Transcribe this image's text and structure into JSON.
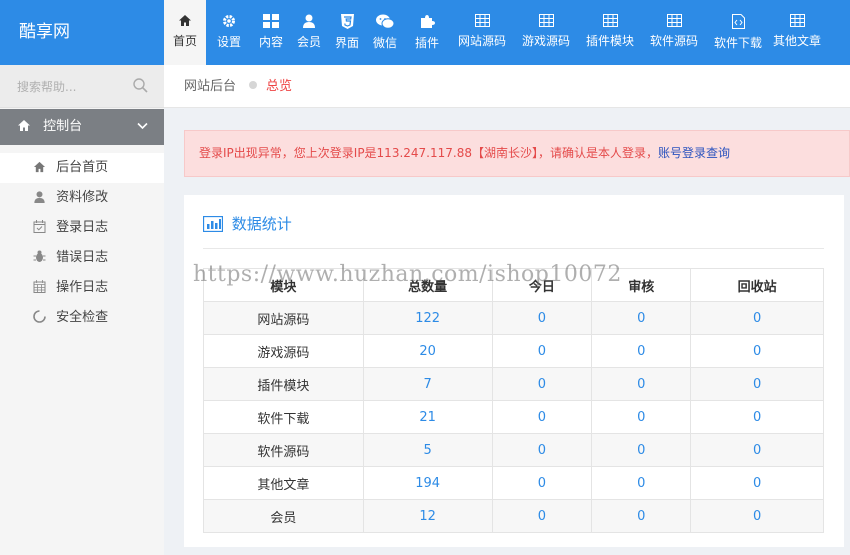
{
  "brand": "酷享网",
  "nav": [
    {
      "label": "首页",
      "icon": "home-icon",
      "active": true
    },
    {
      "label": "设置",
      "icon": "gear-icon"
    },
    {
      "label": "内容",
      "icon": "grid-icon"
    },
    {
      "label": "会员",
      "icon": "user-icon"
    },
    {
      "label": "界面",
      "icon": "html5-icon"
    },
    {
      "label": "微信",
      "icon": "wechat-icon"
    },
    {
      "label": "插件",
      "icon": "puzzle-icon"
    },
    {
      "label": "网站源码",
      "icon": "table-icon"
    },
    {
      "label": "游戏源码",
      "icon": "table-icon"
    },
    {
      "label": "插件模块",
      "icon": "table-icon"
    },
    {
      "label": "软件源码",
      "icon": "table-icon"
    },
    {
      "label": "软件下载",
      "icon": "file-code-icon"
    },
    {
      "label": "其他文章",
      "icon": "table-icon"
    }
  ],
  "sidebar": {
    "search_placeholder": "搜索帮助...",
    "section_title": "控制台",
    "items": [
      {
        "label": "后台首页",
        "icon": "home-icon"
      },
      {
        "label": "资料修改",
        "icon": "user-icon"
      },
      {
        "label": "登录日志",
        "icon": "calendar-check-icon"
      },
      {
        "label": "错误日志",
        "icon": "bug-icon"
      },
      {
        "label": "操作日志",
        "icon": "calendar-icon"
      },
      {
        "label": "安全检查",
        "icon": "spinner-icon"
      }
    ]
  },
  "breadcrumb": {
    "root": "网站后台",
    "current": "总览"
  },
  "alert": {
    "text": "登录IP出现异常，您上次登录IP是113.247.117.88【湖南长沙】，请确认是本人登录，",
    "link": "账号登录查询"
  },
  "stats": {
    "title": "数据统计",
    "columns": [
      "模块",
      "总数量",
      "今日",
      "审核",
      "回收站"
    ],
    "rows": [
      [
        "网站源码",
        "122",
        "0",
        "0",
        "0"
      ],
      [
        "游戏源码",
        "20",
        "0",
        "0",
        "0"
      ],
      [
        "插件模块",
        "7",
        "0",
        "0",
        "0"
      ],
      [
        "软件下载",
        "21",
        "0",
        "0",
        "0"
      ],
      [
        "软件源码",
        "5",
        "0",
        "0",
        "0"
      ],
      [
        "其他文章",
        "194",
        "0",
        "0",
        "0"
      ],
      [
        "会员",
        "12",
        "0",
        "0",
        "0"
      ]
    ]
  },
  "watermark": "https://www.huzhan.com/ishop10072",
  "colors": {
    "primary": "#2d8be6",
    "sidebar_head": "#7b7f84",
    "alert_bg": "#fcdede",
    "alert_text": "#e44a4a"
  }
}
